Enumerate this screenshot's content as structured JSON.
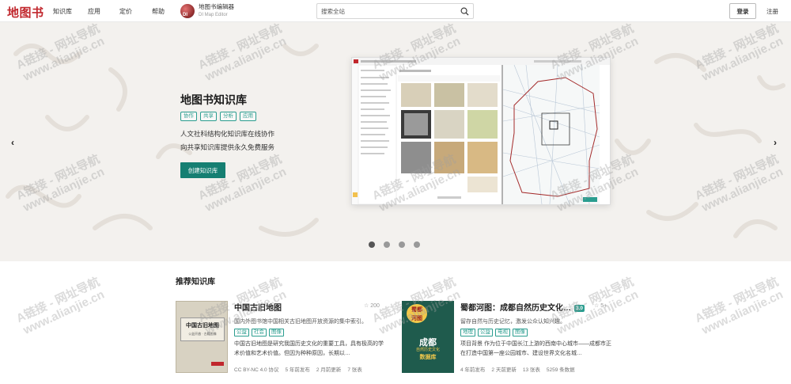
{
  "header": {
    "logo": "地图书",
    "nav": [
      "知识库",
      "应用",
      "定价",
      "帮助"
    ],
    "brand_name": "地图书编辑器",
    "brand_sub": "DI Map Editor",
    "brand_badge": "DI",
    "search_placeholder": "搜索全站",
    "login": "登录",
    "register": "注册"
  },
  "hero": {
    "title": "地图书知识库",
    "tags": [
      "协作",
      "共享",
      "分析",
      "应用"
    ],
    "desc_line1": "人文社科结构化知识库在线协作",
    "desc_line2": "向共享知识库提供永久免费服务",
    "create_button": "创建知识库",
    "prev_arrow": "‹",
    "next_arrow": "›",
    "slide_count": 4,
    "active_slide": 1
  },
  "recommended": {
    "title": "推荐知识库",
    "cards": [
      {
        "name": "中国古旧地图",
        "stars": "☆ 200",
        "subtitle": "国内外图书馆中国相关古旧地图开放资源的集中索引。",
        "tags": [
          "公益",
          "社会",
          "图像"
        ],
        "desc": "中国古旧地图是研究我国历史文化的重要工具，具有极高的学术价值和艺术价值。但因为种种原因，长期以…",
        "meta": [
          "CC BY-NC 4.0 协议",
          "5 年前发布",
          "2 月前更新",
          "7 张表"
        ],
        "cover_title": "中国古旧地图",
        "cover_sub": "公益开放 · 古籍图像"
      },
      {
        "name": "蜀都河图：成都自然历史文化…",
        "badge": "3.0",
        "stars": "☆ 5+",
        "subtitle": "留存自然与历史记忆，激发公众认知兴趣。",
        "tags": [
          "地理",
          "公益",
          "电视",
          "图像"
        ],
        "desc": "项目背景 作为位于中国长江上游的西南中心城市——成都市正在打造中国第一座公园城市、建设世界文化名城…",
        "meta": [
          "4 年前发布",
          "2 天前更新",
          "13 张表",
          "5259 条数据"
        ],
        "cover_line1": "蜀都",
        "cover_line2": "河图",
        "cover_city": "成都",
        "cover_sub": "自然历史文化",
        "cover_tail": "数据库"
      }
    ]
  },
  "watermark": {
    "line1": "A链接 - 网址导航",
    "line2": "www.alianjie.cn"
  },
  "colors": {
    "brand_red": "#c1272d",
    "accent_teal": "#167f72",
    "tag_teal": "#2a9d8f"
  }
}
